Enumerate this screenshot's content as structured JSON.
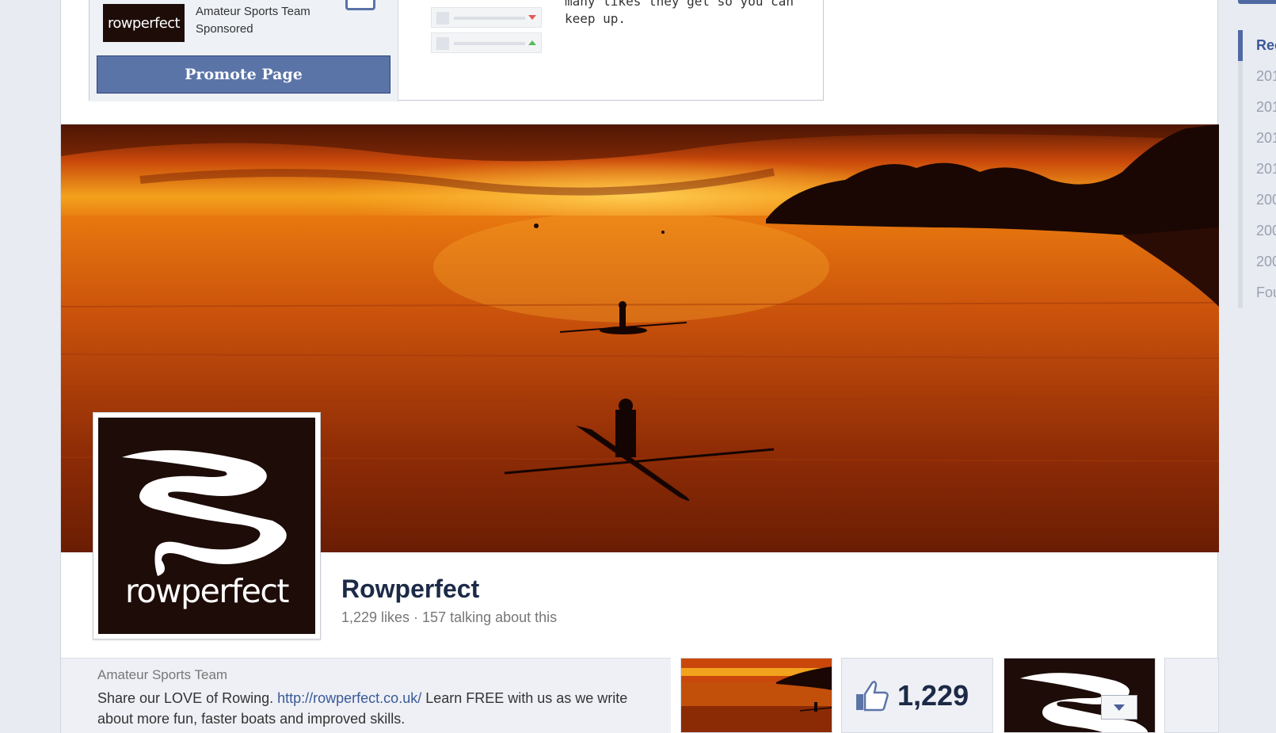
{
  "promo": {
    "category": "Amateur Sports Team",
    "sponsored": "Sponsored",
    "logo_text": "rowperfect",
    "button_label": "Promote Page",
    "text": "many likes they get so you can keep up."
  },
  "page": {
    "name": "Rowperfect",
    "stats": "1,229 likes · 157 talking about this",
    "profile_wordmark": "rowperfect"
  },
  "about": {
    "category": "Amateur Sports Team",
    "desc_before": "Share our LOVE of Rowing. ",
    "link": "http://rowperfect.co.uk/",
    "desc_after": " Learn FREE with us as we write about more fun, faster boats and improved skills."
  },
  "apps": {
    "likes_count": "1,229"
  },
  "timeline": {
    "items": [
      "Rec",
      "201",
      "201",
      "201",
      "201",
      "200",
      "200",
      "200",
      "Fou"
    ]
  },
  "colors": {
    "facebook_blue": "#3b5998",
    "button_blue": "#5b74a8",
    "logo_dark": "#1d0c08"
  },
  "icons": [
    "thumbs-up-icon",
    "chevron-down-icon",
    "trend-down-icon",
    "trend-up-icon"
  ]
}
